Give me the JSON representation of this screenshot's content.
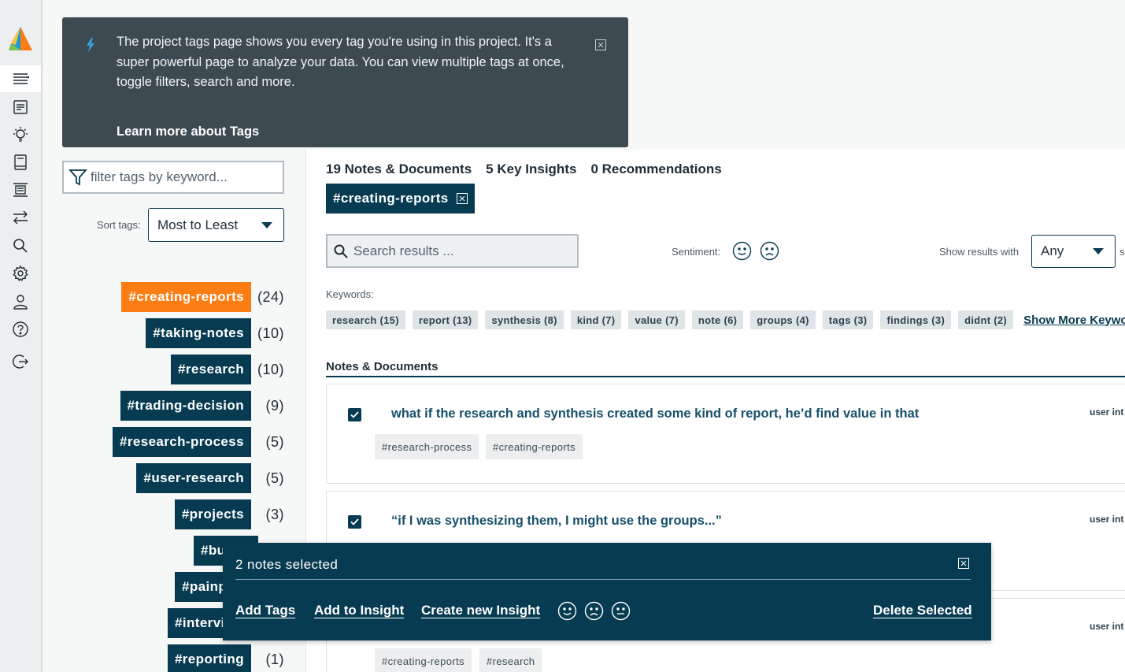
{
  "sidebar": {
    "items": [
      {
        "name": "notes-list-icon",
        "active": true
      },
      {
        "name": "documents-icon",
        "active": false
      },
      {
        "name": "insights-bulb-icon",
        "active": false
      },
      {
        "name": "book-icon",
        "active": false
      },
      {
        "name": "present-icon",
        "active": false
      },
      {
        "name": "transfer-arrows-icon",
        "active": false
      },
      {
        "name": "search-icon",
        "active": false
      },
      {
        "name": "gear-icon",
        "active": false
      },
      {
        "name": "user-icon",
        "active": false
      },
      {
        "name": "help-icon",
        "active": false
      },
      {
        "name": "logout-icon",
        "active": false
      }
    ]
  },
  "banner": {
    "text": "The project tags page shows you every tag you're using in this project. It's a super powerful page to analyze your data. You can view multiple tags at once, toggle filters, search and more.",
    "link": "Learn more about Tags"
  },
  "filter": {
    "placeholder": "filter tags by keyword..."
  },
  "sort": {
    "label": "Sort tags:",
    "value": "Most to Least"
  },
  "tags": [
    {
      "label": "#creating-reports",
      "count": "(24)",
      "selected": true
    },
    {
      "label": "#taking-notes",
      "count": "(10)"
    },
    {
      "label": "#research",
      "count": "(10)"
    },
    {
      "label": "#trading-decision",
      "count": "(9)"
    },
    {
      "label": "#research-process",
      "count": "(5)"
    },
    {
      "label": "#user-research",
      "count": "(5)"
    },
    {
      "label": "#projects",
      "count": "(3)"
    },
    {
      "label": "#bu",
      "count": ""
    },
    {
      "label": "#painp",
      "count": ""
    },
    {
      "label": "#intervi",
      "count": ""
    },
    {
      "label": "#reporting",
      "count": "(1)"
    }
  ],
  "counts": {
    "notes": "19 Notes & Documents",
    "insights": "5 Key Insights",
    "recs": "0 Recommendations"
  },
  "active_tag": "#creating-reports",
  "search": {
    "placeholder": "Search results ..."
  },
  "sentiment_label": "Sentiment:",
  "show_results": {
    "label": "Show results with",
    "value": "Any",
    "cut": "s"
  },
  "keywords": {
    "label": "Keywords:",
    "items": [
      "research (15)",
      "report (13)",
      "synthesis (8)",
      "kind (7)",
      "value (7)",
      "note (6)",
      "groups (4)",
      "tags (3)",
      "findings (3)",
      "didnt (2)"
    ],
    "more": "Show More Keywords"
  },
  "notes_section": "Notes & Documents",
  "cards": [
    {
      "title": "what if the research and synthesis created some kind of report, he’d find value in that",
      "meta": "user int",
      "tags": [
        "#research-process",
        "#creating-reports"
      ]
    },
    {
      "title": "“if I was synthesizing them, I might use the groups...”",
      "meta": "user int",
      "tags": []
    },
    {
      "title": "",
      "meta": "user int",
      "tags": [
        "#creating-reports",
        "#research"
      ]
    }
  ],
  "selection": {
    "count": "2 notes selected",
    "add_tags": "Add Tags",
    "add_insight": "Add to Insight",
    "create_insight": "Create new Insight",
    "delete": "Delete Selected"
  },
  "colors": {
    "accent": "#073b52",
    "selected_tag": "#fb7d13",
    "banner": "#3e4a51"
  }
}
